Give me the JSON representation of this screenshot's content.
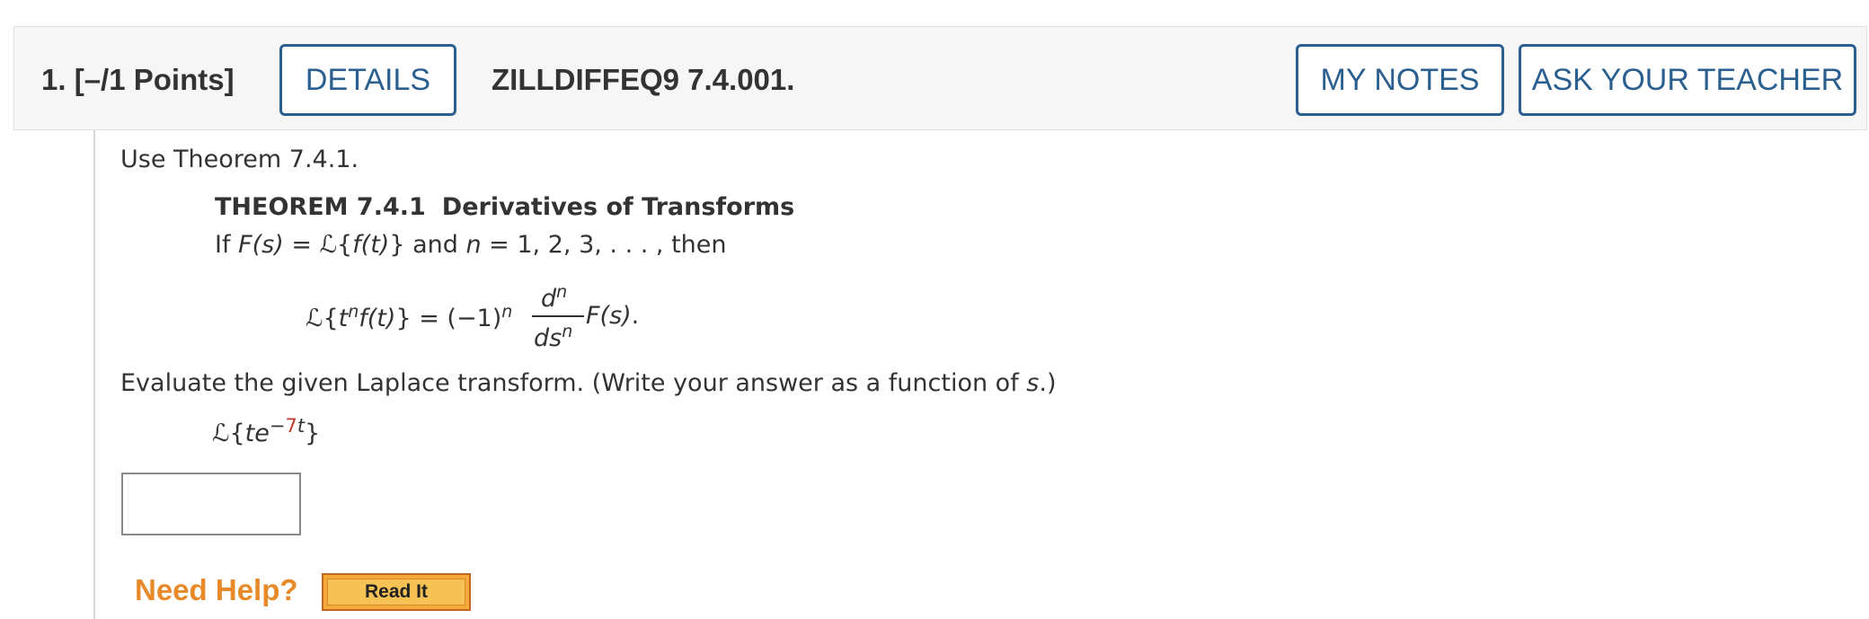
{
  "header": {
    "question_number": "1.",
    "points": "[–/1 Points]",
    "details_label": "DETAILS",
    "question_code": "ZILLDIFFEQ9 7.4.001.",
    "my_notes_label": "MY NOTES",
    "ask_teacher_label": "ASK YOUR TEACHER"
  },
  "content": {
    "intro": "Use Theorem 7.4.1.",
    "theorem_label": "THEOREM 7.4.1",
    "theorem_name": "Derivatives of Transforms",
    "if_line": {
      "prefix": "If ",
      "Fs": "F(s)",
      "eq": " = ℒ{",
      "ft": "f(t)",
      "mid": "} and ",
      "n": "n",
      "suffix": " = 1, 2, 3, . . . , then"
    },
    "formula": {
      "L_open": "ℒ{",
      "t": "t",
      "n_exp": "n",
      "ft": "f(t)",
      "middle": "} = (−1)",
      "n_exp2": "n",
      "frac_num_d": "d",
      "frac_num_n": "n",
      "frac_den_ds": "ds",
      "frac_den_n": "n",
      "Fs": "F(s)",
      "period": "."
    },
    "evaluate": {
      "text": "Evaluate the given Laplace transform. (Write your answer as a function of ",
      "s": "s",
      "close": ".)"
    },
    "expression": {
      "L_open": "ℒ{",
      "te": "te",
      "exponent_sign": "−",
      "exponent_value": "7",
      "exponent_var": "t",
      "close": "}"
    },
    "answer": {
      "value": "",
      "placeholder": ""
    }
  },
  "help": {
    "label": "Need Help?",
    "read_it_label": "Read It"
  },
  "colors": {
    "accent_blue": "#2a5f8f",
    "help_orange": "#e8892a",
    "exponent_red": "#c0392b"
  }
}
